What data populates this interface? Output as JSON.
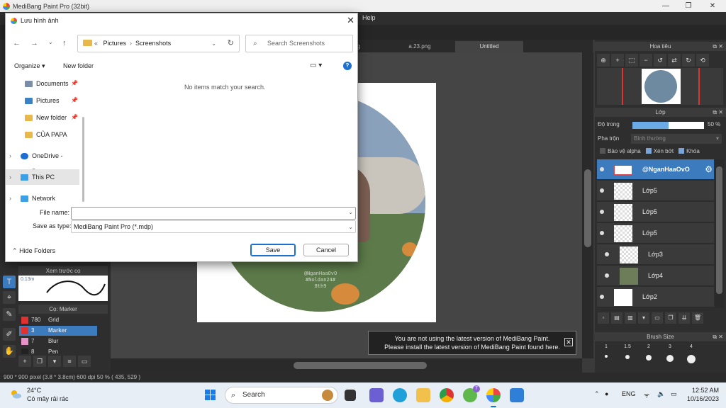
{
  "app": {
    "title": "MediBang Paint Pro (32bit)",
    "menu_help": "Help",
    "win_minimize": "—",
    "win_maximize": "❐",
    "win_close": "✕"
  },
  "tabs": [
    {
      "label": "g"
    },
    {
      "label": "a.23.png"
    },
    {
      "label": "Untitled"
    }
  ],
  "artwork": {
    "watermark_lines": [
      "@NganHaaOvO",
      "#Noldan24#",
      "8th9"
    ]
  },
  "left": {
    "preview_panel_title": "Xem trước cọ",
    "preview_size": "0.13m",
    "brush_panel_title": "Cọ: Marker",
    "brushes": [
      {
        "size": "780",
        "name": "Grid",
        "color": "#e03030"
      },
      {
        "size": "3",
        "name": "Marker",
        "color": "#e03030"
      },
      {
        "size": "7",
        "name": "Blur",
        "color": "#e890c8"
      },
      {
        "size": "8",
        "name": "Pen",
        "color": "#222222"
      }
    ]
  },
  "right": {
    "navigator_title": "Hoa tiêu",
    "layer_title": "Lớp",
    "opacity_label": "Độ trong",
    "opacity_value": "50 %",
    "opacity_fraction": 0.5,
    "blend_label": "Pha trộn",
    "blend_value": "Bình thường",
    "protect_alpha": "Bảo vệ alpha",
    "clipping": "Xén bớt",
    "lock": "Khóa",
    "layers": [
      {
        "name": "@NganHaaOvO",
        "selected": true
      },
      {
        "name": "Lớp5",
        "selected": false
      },
      {
        "name": "Lớp5",
        "selected": false
      },
      {
        "name": "Lớp5",
        "selected": false
      },
      {
        "name": "Lớp3",
        "selected": false
      },
      {
        "name": "Lớp4",
        "selected": false
      },
      {
        "name": "Lớp2",
        "selected": false
      }
    ],
    "brush_size_title": "Brush Size",
    "brush_sizes": [
      "1",
      "1.5",
      "2",
      "3",
      "4"
    ]
  },
  "status": {
    "text": "900 * 900 pixel   (3.8 * 3.8cm)   600 dpi   50 %   ( 435, 529 )"
  },
  "toast": {
    "line1": "You are not using the latest version of MediBang Paint.",
    "line2": "Please install the latest version of MediBang Paint found here.",
    "close": "✕"
  },
  "dialog": {
    "title": "Lưu hình ảnh",
    "breadcrumb": [
      "Pictures",
      "Screenshots"
    ],
    "search_placeholder": "Search Screenshots",
    "organize": "Organize ▾",
    "new_folder": "New folder",
    "empty_message": "No items match your search.",
    "nav_items": [
      {
        "label": "Documents",
        "pinned": true,
        "icon_color": "#7a8da6"
      },
      {
        "label": "Pictures",
        "pinned": true,
        "icon_color": "#3b82c4"
      },
      {
        "label": "New folder",
        "pinned": true,
        "icon_color": "#e8b84a"
      },
      {
        "label": "CỦA PAPA",
        "pinned": false,
        "icon_color": "#e8b84a"
      },
      {
        "label": "OneDrive - Perso",
        "pinned": false,
        "icon_color": "#1a6fd1"
      },
      {
        "label": "This PC",
        "pinned": false,
        "icon_color": "#3aa0e8"
      },
      {
        "label": "Network",
        "pinned": false,
        "icon_color": "#3aa0e8"
      }
    ],
    "file_name_label": "File name:",
    "file_name_value": "",
    "save_type_label": "Save as type:",
    "save_type_value": "MediBang Paint Pro (*.mdp)",
    "hide_folders": "Hide Folders",
    "save": "Save",
    "cancel": "Cancel"
  },
  "taskbar": {
    "temp": "24°C",
    "weather": "Có mây rải rác",
    "search": "Search",
    "lang": "ENG",
    "time": "12:52 AM",
    "date": "10/16/2023",
    "badge": "7"
  }
}
